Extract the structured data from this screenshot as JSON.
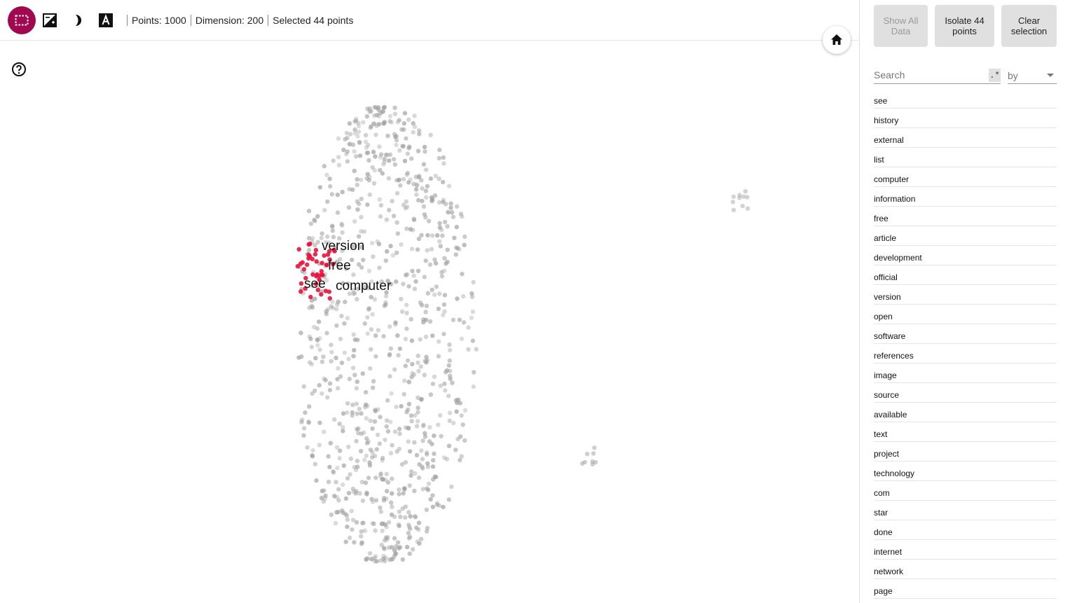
{
  "toolbar": {
    "tools": [
      {
        "name": "bounding-box-select",
        "icon": "select-rect-icon",
        "active": true
      },
      {
        "name": "night-mode",
        "icon": "contrast-icon"
      },
      {
        "name": "label-3d",
        "icon": "half-moon-icon"
      },
      {
        "name": "labels",
        "icon": "text-label-icon"
      }
    ],
    "points_label": "Points: 1000",
    "dimension_label": "Dimension: 200",
    "selected_label": "Selected 44 points"
  },
  "colors": {
    "accent": "#a0094f",
    "selected_point": "#e8123c",
    "point": "#9e9e9e"
  },
  "panel": {
    "show_all_label": "Show All Data",
    "isolate_label": "Isolate 44 points",
    "clear_label": "Clear selection",
    "search_placeholder": "Search",
    "regex_label": ".*",
    "by_placeholder": "by",
    "words": [
      "see",
      "history",
      "external",
      "list",
      "computer",
      "information",
      "free",
      "article",
      "development",
      "official",
      "version",
      "open",
      "software",
      "references",
      "image",
      "source",
      "available",
      "text",
      "project",
      "technology",
      "com",
      "star",
      "done",
      "internet",
      "network",
      "page"
    ]
  },
  "scatter": {
    "labels": [
      "version",
      "free",
      "see",
      "computer"
    ],
    "selected_count": 44
  }
}
